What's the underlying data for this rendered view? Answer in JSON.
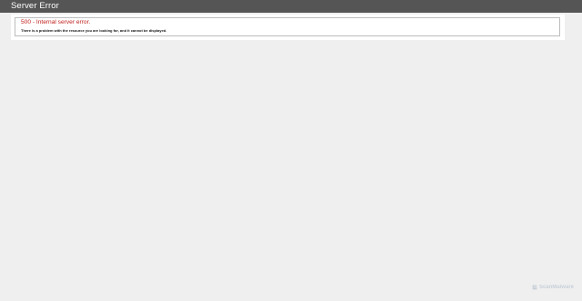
{
  "header": {
    "title": "Server Error"
  },
  "error": {
    "title": "500 - Internal server error.",
    "message": "There is a problem with the resource you are looking for, and it cannot be displayed."
  },
  "brand": {
    "name": "ScanMalware",
    "icon": "scanmalware-logo-icon"
  },
  "colors": {
    "header_bg": "#555555",
    "page_bg": "#efefef",
    "error_title": "#c0201c",
    "brand_text": "#a9b8c9"
  }
}
